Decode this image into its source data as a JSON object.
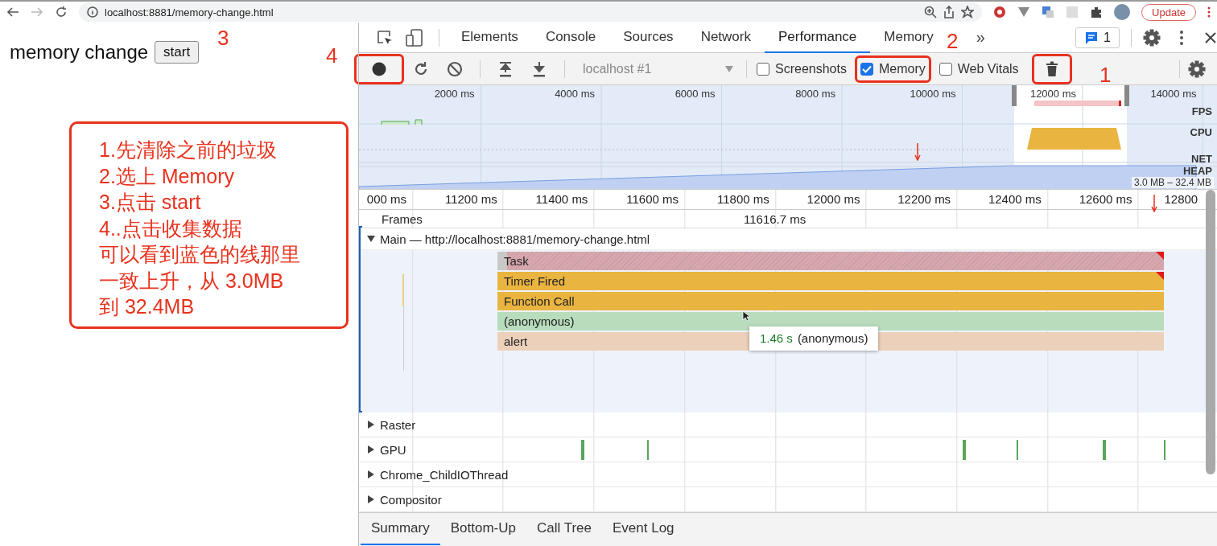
{
  "browser": {
    "url": "localhost:8881/memory-change.html",
    "update_label": "Update"
  },
  "page": {
    "heading": "memory change",
    "button": "start"
  },
  "note": {
    "lines": [
      "1.先清除之前的垃圾",
      "2.选上 Memory",
      "3.点击 start",
      "4..点击收集数据",
      "可以看到蓝色的线那里",
      "一致上升，从 3.0MB",
      "到 32.4MB"
    ]
  },
  "markers": [
    {
      "label": "3"
    },
    {
      "label": "4"
    },
    {
      "label": "2"
    },
    {
      "label": "1"
    }
  ],
  "devtools": {
    "tabs": [
      {
        "label": "Elements",
        "selected": false
      },
      {
        "label": "Console",
        "selected": false
      },
      {
        "label": "Sources",
        "selected": false
      },
      {
        "label": "Network",
        "selected": false
      },
      {
        "label": "Performance",
        "selected": true
      },
      {
        "label": "Memory",
        "selected": false
      }
    ],
    "more_tabs": "»",
    "issues_count": "1",
    "record_highlighted": true,
    "profile": "localhost #1",
    "options": [
      {
        "label": "Screenshots",
        "checked": false,
        "highlighted": false
      },
      {
        "label": "Memory",
        "checked": true,
        "highlighted": true
      },
      {
        "label": "Web Vitals",
        "checked": false,
        "highlighted": false
      }
    ],
    "gc_highlighted": true,
    "overview": {
      "ticks": [
        "2000 ms",
        "4000 ms",
        "6000 ms",
        "8000 ms",
        "10000 ms",
        "12000 ms",
        "14000 ms"
      ],
      "tracks": [
        "FPS",
        "CPU",
        "NET",
        "HEAP"
      ],
      "heap_range": "3.0 MB – 32.4 MB"
    },
    "ruler": [
      "000 ms",
      "11200 ms",
      "11400 ms",
      "11600 ms",
      "11800 ms",
      "12000 ms",
      "12200 ms",
      "12400 ms",
      "12600 ms",
      "12800"
    ],
    "frames": {
      "label": "Frames",
      "duration": "11616.7 ms"
    },
    "main": {
      "label": "Main — http://localhost:8881/memory-change.html",
      "expanded": true,
      "events": [
        {
          "name": "Task",
          "kind": "task",
          "color": "#d9a7ad",
          "warning": true
        },
        {
          "name": "Timer Fired",
          "kind": "event",
          "color": "#e9b440",
          "warning": true
        },
        {
          "name": "Function Call",
          "kind": "event",
          "color": "#e9b440",
          "warning": false
        },
        {
          "name": "(anonymous)",
          "kind": "event",
          "color": "#b8dcbc",
          "warning": false
        },
        {
          "name": "alert",
          "kind": "event",
          "color": "#ecd0ba",
          "warning": false
        }
      ]
    },
    "tooltip": {
      "duration": "1.46 s",
      "name": "(anonymous)"
    },
    "threads": [
      {
        "name": "Raster",
        "expanded": false
      },
      {
        "name": "GPU",
        "expanded": false
      },
      {
        "name": "Chrome_ChildIOThread",
        "expanded": false
      },
      {
        "name": "Compositor",
        "expanded": false
      }
    ],
    "bottom_tabs": [
      {
        "label": "Summary",
        "selected": true
      },
      {
        "label": "Bottom-Up",
        "selected": false
      },
      {
        "label": "Call Tree",
        "selected": false
      },
      {
        "label": "Event Log",
        "selected": false
      }
    ]
  }
}
